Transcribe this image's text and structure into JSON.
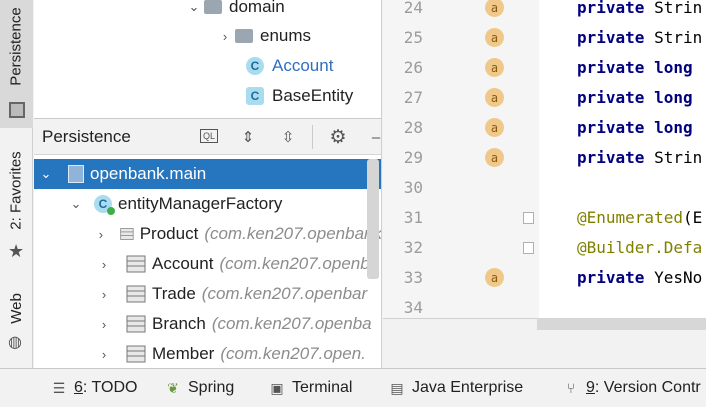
{
  "left_strip": {
    "tabs": [
      {
        "label": "Persistence"
      },
      {
        "label": "2: Favorites"
      },
      {
        "label": "Web"
      }
    ]
  },
  "project_tree": {
    "items": [
      {
        "label": "domain",
        "kind": "folder"
      },
      {
        "label": "enums",
        "kind": "folder"
      },
      {
        "label": "Account",
        "kind": "class"
      },
      {
        "label": "BaseEntity",
        "kind": "class"
      }
    ],
    "class_icon_letter": "C"
  },
  "persistence": {
    "title": "Persistence",
    "toolbar": {
      "ql_label": "QL"
    },
    "root": "openbank.main",
    "factory": "entityManagerFactory",
    "entities": [
      {
        "name": "Product",
        "package": "(com.ken207.openbank"
      },
      {
        "name": "Account",
        "package": "(com.ken207.openb"
      },
      {
        "name": "Trade",
        "package": "(com.ken207.openbar"
      },
      {
        "name": "Branch",
        "package": "(com.ken207.openba"
      },
      {
        "name": "Member",
        "package": "(com.ken207.open."
      }
    ]
  },
  "editor": {
    "line_numbers": [
      "24",
      "25",
      "26",
      "27",
      "28",
      "29",
      "30",
      "31",
      "32",
      "33",
      "34"
    ],
    "annotation_icon_letter": "a",
    "lines": [
      {
        "kw": "private",
        "rest": "Strin"
      },
      {
        "kw": "private",
        "rest": "Strin"
      },
      {
        "kw": "private",
        "rest": "long"
      },
      {
        "kw": "private",
        "rest": "long"
      },
      {
        "kw": "private",
        "rest": "long"
      },
      {
        "kw": "private",
        "rest": "Strin"
      },
      {
        "kw": "",
        "rest": ""
      },
      {
        "anno": "@Enumerated",
        "rest": "(E"
      },
      {
        "anno": "@Builder.Defa",
        "rest": ""
      },
      {
        "kw": "private",
        "rest": "YesNo"
      },
      {
        "kw": "",
        "rest": ""
      }
    ]
  },
  "bottom_bar": {
    "items": [
      {
        "key": "6",
        "label": ": TODO"
      },
      {
        "key": "",
        "label": "Spring"
      },
      {
        "key": "",
        "label": "Terminal"
      },
      {
        "key": "",
        "label": "Java Enterprise"
      },
      {
        "key": "9",
        "label": ": Version Contr"
      }
    ]
  },
  "colors": {
    "selection": "#2675bf",
    "keyword": "#000080",
    "annotation": "#808000",
    "class_link": "#2f6fc0",
    "annotation_icon": "#f0c98a"
  }
}
